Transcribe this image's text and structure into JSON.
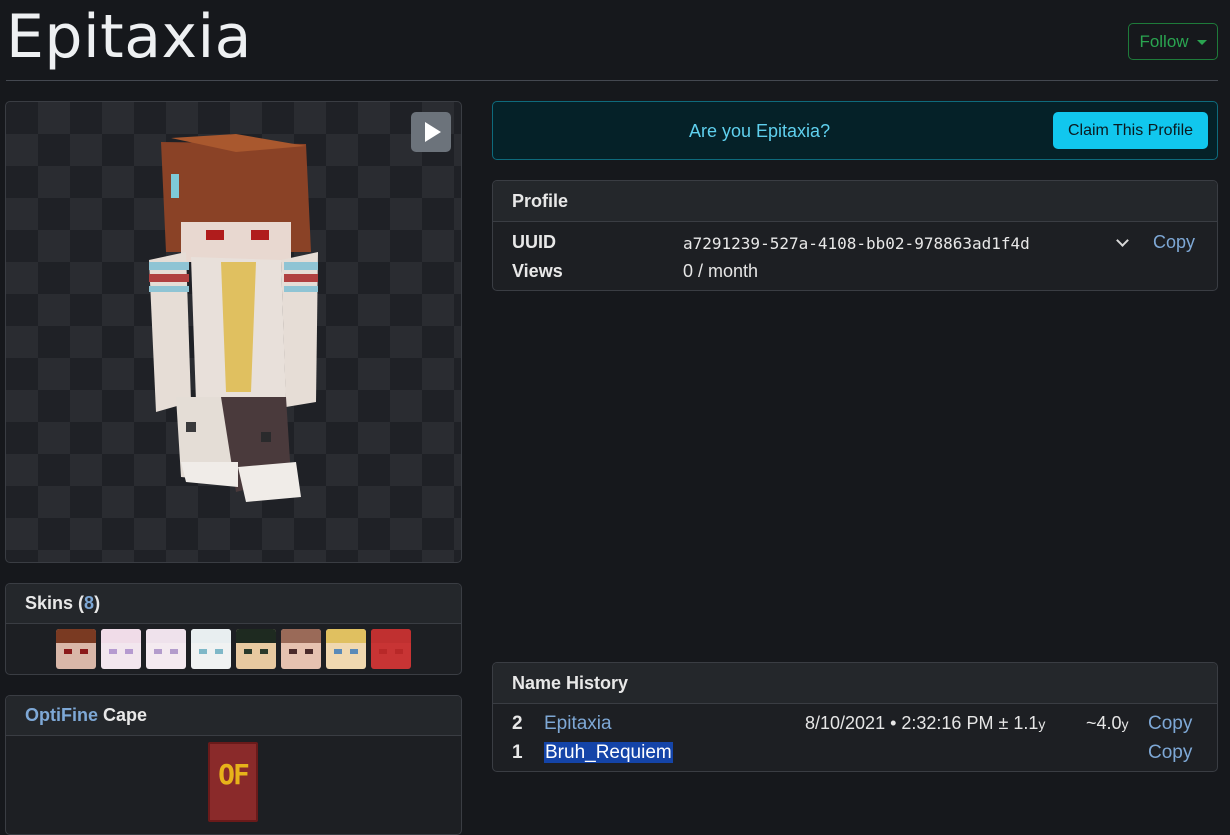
{
  "header": {
    "title": "Epitaxia",
    "follow_label": "Follow"
  },
  "skins": {
    "title": "Skins",
    "count_open": "(",
    "count": "8",
    "count_close": ")",
    "thumbs": [
      {
        "hair": "#7a3a22",
        "face": "#d9b7a8",
        "eye": "#8a1a1a"
      },
      {
        "hair": "#f0dce8",
        "face": "#f2e6ee",
        "eye": "#b59ad0"
      },
      {
        "hair": "#efe2ec",
        "face": "#f4eaf0",
        "eye": "#b39ccc"
      },
      {
        "hair": "#e8eef0",
        "face": "#f0f2f2",
        "eye": "#7fb8c8"
      },
      {
        "hair": "#1e2a20",
        "face": "#e8c9a0",
        "eye": "#2a3a2a"
      },
      {
        "hair": "#9a6a58",
        "face": "#e6c2b0",
        "eye": "#4a2a2a"
      },
      {
        "hair": "#e0c060",
        "face": "#f0d8b0",
        "eye": "#5a8ab8"
      },
      {
        "hair": "#c03030",
        "face": "#c83434",
        "eye": "#b82828"
      }
    ]
  },
  "cape": {
    "provider": "OptiFine",
    "label": "Cape",
    "text": "OF"
  },
  "claim": {
    "question": "Are you Epitaxia?",
    "button": "Claim This Profile"
  },
  "profile": {
    "title": "Profile",
    "uuid_label": "UUID",
    "uuid_value": "a7291239-527a-4108-bb02-978863ad1f4d",
    "copy_label": "Copy",
    "views_label": "Views",
    "views_value": "0 / month"
  },
  "name_history": {
    "title": "Name History",
    "rows": [
      {
        "index": "2",
        "name": "Epitaxia",
        "date": "8/10/2021 • 2:32:16 PM ± 1.1",
        "date_unit": "y",
        "age": "~4.0",
        "age_unit": "y",
        "copy": "Copy"
      },
      {
        "index": "1",
        "name": "Bruh_Requiem",
        "copy": "Copy"
      }
    ]
  },
  "colors": {
    "accent": "#11c7ee",
    "link": "#7ea8d6",
    "follow": "#2aa450"
  }
}
